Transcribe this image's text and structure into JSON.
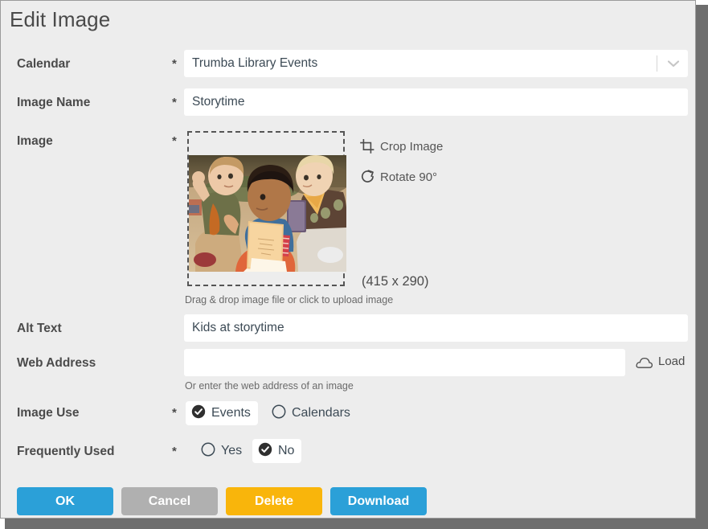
{
  "dialog": {
    "title": "Edit Image",
    "required_marker": "*"
  },
  "fields": {
    "calendar": {
      "label": "Calendar",
      "value": "Trumba Library Events",
      "required": "*",
      "dropdown_icon": "chevron-down-icon"
    },
    "image_name": {
      "label": "Image Name",
      "value": "Storytime",
      "placeholder": "",
      "required": "*"
    },
    "image": {
      "label": "Image",
      "required": "*",
      "dropzone_hint": "Drag & drop image file or click to upload image",
      "dimensions": "(415 x 290)",
      "alt_description": "Kids sitting on carpet at storytime, one holding an open book",
      "tools": [
        {
          "label": "Crop Image",
          "icon": "crop-icon"
        },
        {
          "label": "Rotate 90°",
          "icon": "rotate-cw-icon"
        }
      ]
    },
    "alt_text": {
      "label": "Alt Text",
      "value": "Kids at storytime",
      "placeholder": ""
    },
    "web_address": {
      "label": "Web Address",
      "value": "",
      "placeholder": "",
      "hint": "Or enter the web address of an image",
      "load_label": "Load",
      "load_icon": "cloud-icon"
    },
    "image_use": {
      "label": "Image Use",
      "required": "*",
      "options": [
        {
          "label": "Events",
          "selected": true
        },
        {
          "label": "Calendars",
          "selected": false
        }
      ]
    },
    "frequently_used": {
      "label": "Frequently Used",
      "required": "*",
      "options": [
        {
          "label": "Yes",
          "selected": false
        },
        {
          "label": "No",
          "selected": true
        }
      ]
    }
  },
  "buttons": [
    {
      "label": "OK",
      "color": "#2ba0d8"
    },
    {
      "label": "Cancel",
      "color": "#b0b0b0"
    },
    {
      "label": "Delete",
      "color": "#f9b50b"
    },
    {
      "label": "Download",
      "color": "#2ba0d8"
    }
  ],
  "colors": {
    "background": "#ededed",
    "field_bg": "#ffffff",
    "text": "#4b4b4b",
    "primary": "#2ba0d8",
    "warning": "#f9b50b",
    "muted": "#b0b0b0",
    "frame": "#6e6e6e"
  }
}
